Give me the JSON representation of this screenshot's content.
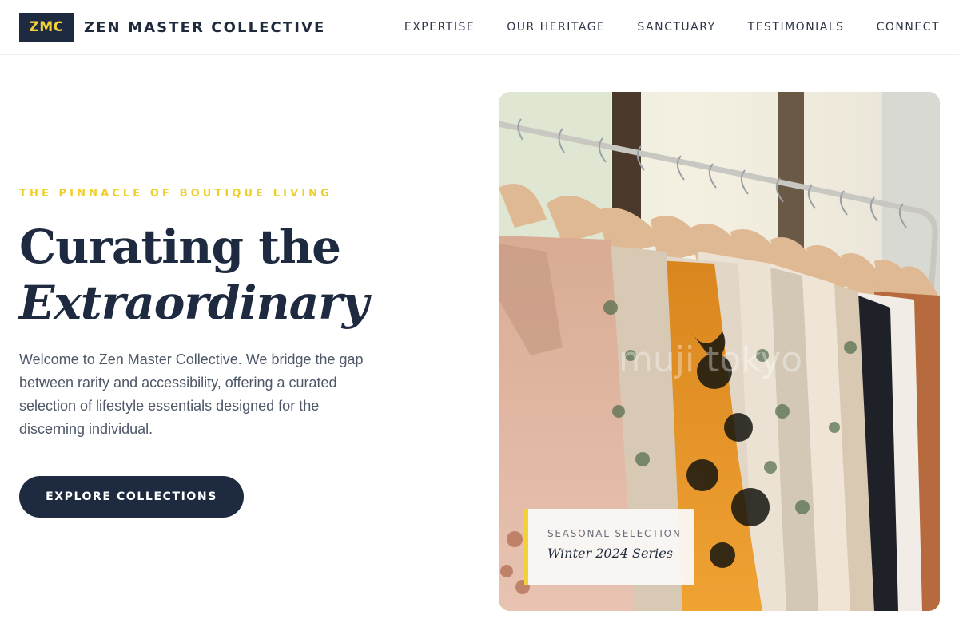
{
  "brand": {
    "logo_text": "ZMC",
    "name": "ZEN MASTER COLLECTIVE"
  },
  "nav": {
    "items": [
      {
        "label": "EXPERTISE"
      },
      {
        "label": "OUR HERITAGE"
      },
      {
        "label": "SANCTUARY"
      },
      {
        "label": "TESTIMONIALS"
      },
      {
        "label": "CONNECT"
      }
    ]
  },
  "hero": {
    "eyebrow": "THE PINNACLE OF BOUTIQUE LIVING",
    "headline_line1": "Curating the",
    "headline_line2": "Extraordinary",
    "intro": "Welcome to Zen Master Collective. We bridge the gap between rarity and accessibility, offering a curated selection of lifestyle essentials designed for the discerning individual.",
    "cta_label": "EXPLORE COLLECTIONS"
  },
  "feature_image": {
    "watermark_text": "muji tokyo",
    "caption_label": "SEASONAL SELECTION",
    "caption_title": "Winter 2024 Series"
  },
  "colors": {
    "navy": "#1e2a3f",
    "accent_yellow": "#f2d23b",
    "body_text": "#4e5868"
  }
}
